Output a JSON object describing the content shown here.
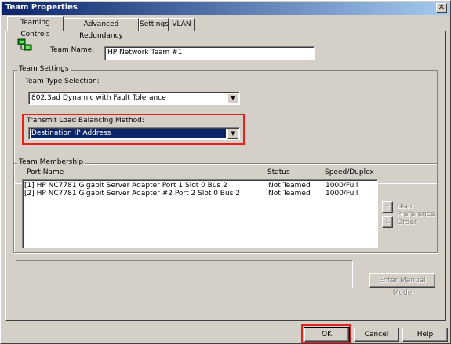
{
  "window": {
    "title": "Team Properties",
    "close_glyph": "✕"
  },
  "tabs": [
    {
      "label": "Teaming Controls",
      "active": true
    },
    {
      "label": "Advanced Redundancy",
      "active": false
    },
    {
      "label": "Settings",
      "active": false
    },
    {
      "label": "VLAN",
      "active": false
    }
  ],
  "team_name": {
    "label": "Team Name:",
    "value": "HP Network Team #1"
  },
  "team_settings": {
    "group_label": "Team Settings",
    "team_type_label": "Team Type Selection:",
    "team_type_value": "802.3ad Dynamic with Fault Tolerance",
    "load_balancing_label": "Transmit Load Balancing Method:",
    "load_balancing_value": "Destination IP Address"
  },
  "team_membership": {
    "group_label": "Team Membership",
    "columns": [
      "Port Name",
      "Status",
      "Speed/Duplex"
    ],
    "rows": [
      {
        "port": "[1] HP NC7781 Gigabit Server Adapter Port 1 Slot 0 Bus 2",
        "status": "Not Teamed",
        "speed": "1000/Full"
      },
      {
        "port": "[2] HP NC7781 Gigabit Server Adapter #2 Port 2 Slot 0 Bus 2",
        "status": "Not Teamed",
        "speed": "1000/Full"
      }
    ],
    "preference_label_line1": "User",
    "preference_label_line2": "Preference",
    "preference_label_line3": "Order"
  },
  "manual_mode_button": "Enter Manual Mode",
  "buttons": {
    "ok": "OK",
    "cancel": "Cancel",
    "help": "Help"
  },
  "highlight_color": "#e8201c"
}
